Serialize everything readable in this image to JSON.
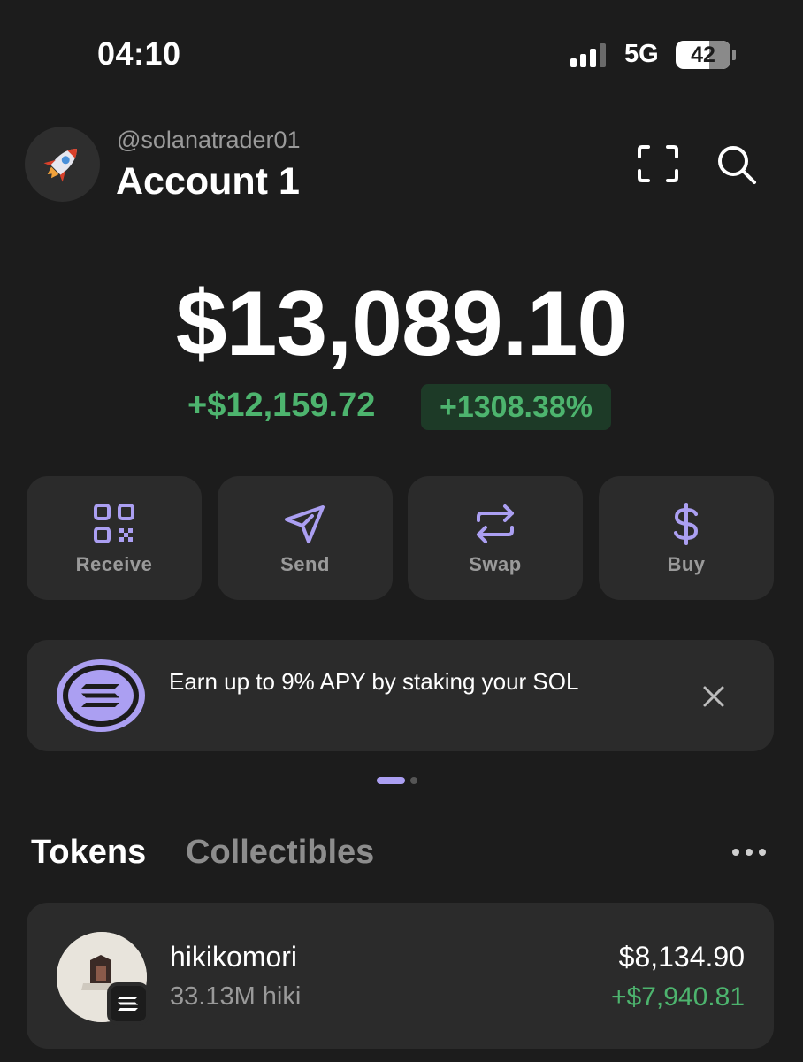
{
  "status_bar": {
    "time": "04:10",
    "network": "5G",
    "battery": "42"
  },
  "header": {
    "handle": "@solanatrader01",
    "account_name": "Account 1",
    "avatar_icon": "rocket-icon"
  },
  "balance": {
    "total": "$13,089.10",
    "change_value": "+$12,159.72",
    "change_percent": "+1308.38%"
  },
  "actions": [
    {
      "label": "Receive",
      "icon": "qr-code-icon"
    },
    {
      "label": "Send",
      "icon": "paper-plane-icon"
    },
    {
      "label": "Swap",
      "icon": "swap-arrows-icon"
    },
    {
      "label": "Buy",
      "icon": "dollar-icon"
    }
  ],
  "promo": {
    "text": "Earn up to 9% APY by staking your SOL",
    "icon": "solana-icon"
  },
  "tabs": {
    "tokens": "Tokens",
    "collectibles": "Collectibles"
  },
  "tokens": [
    {
      "name": "hikikomori",
      "amount": "33.13M hiki",
      "value": "$8,134.90",
      "pnl": "+$7,940.81"
    }
  ],
  "colors": {
    "background": "#1c1c1c",
    "card": "#2b2b2b",
    "accent": "#ab9ff2",
    "positive": "#4db46e"
  }
}
